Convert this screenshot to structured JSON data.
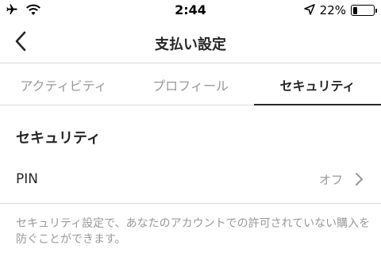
{
  "status_bar": {
    "time": "2:44",
    "battery_percent": "22%",
    "battery_level": 0.22,
    "icons": [
      "airplane-icon",
      "wifi-icon",
      "location-arrow-icon",
      "battery-icon"
    ]
  },
  "nav": {
    "title": "支払い設定",
    "back_icon": "chevron-left-icon"
  },
  "tabs": [
    {
      "label": "アクティビティ",
      "active": false
    },
    {
      "label": "プロフィール",
      "active": false
    },
    {
      "label": "セキュリティ",
      "active": true
    }
  ],
  "section": {
    "title": "セキュリティ",
    "pin_row": {
      "label": "PIN",
      "value": "オフ",
      "icon": "chevron-right-icon"
    },
    "description": "セキュリティ設定で、あなたのアカウントでの許可されていない購入を防ぐことができます。"
  },
  "colors": {
    "text_primary": "#262626",
    "text_secondary": "#999999",
    "divider": "#dbdbdb",
    "background": "#ffffff"
  }
}
